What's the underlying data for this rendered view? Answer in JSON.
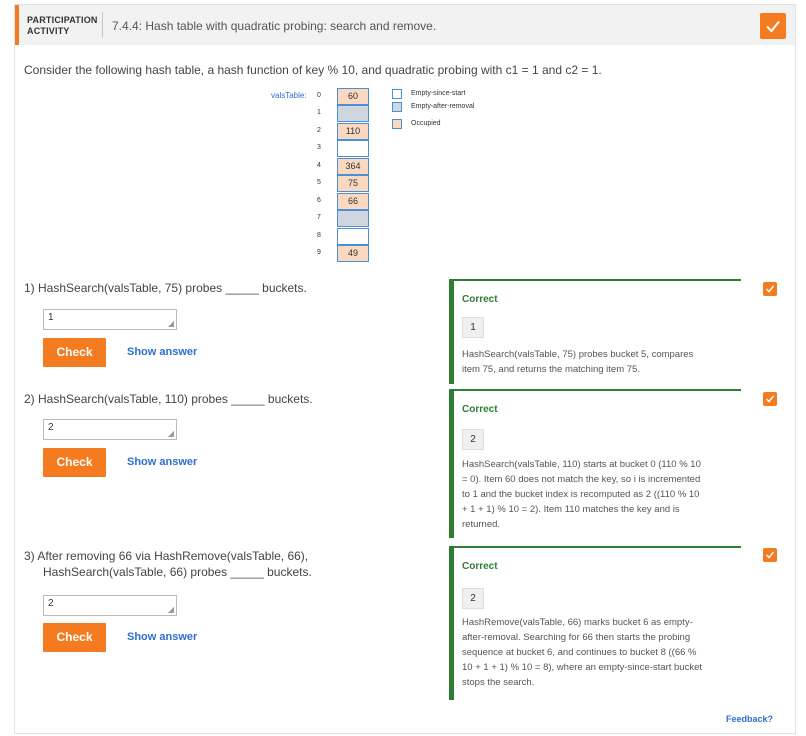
{
  "header": {
    "participation_label_line1": "PARTICIPATION",
    "participation_label_line2": "ACTIVITY",
    "title": "7.4.4: Hash table with quadratic probing: search and remove.",
    "completed_icon": "checkmark-icon"
  },
  "intro": "Consider the following hash table, a hash function of key % 10, and quadratic probing with c1 = 1 and c2 = 1.",
  "table": {
    "label": "valsTable:",
    "buckets": [
      {
        "index": "0",
        "value": "60",
        "state": "occupied"
      },
      {
        "index": "1",
        "value": "",
        "state": "removed"
      },
      {
        "index": "2",
        "value": "110",
        "state": "occupied"
      },
      {
        "index": "3",
        "value": "",
        "state": "empty"
      },
      {
        "index": "4",
        "value": "364",
        "state": "occupied"
      },
      {
        "index": "5",
        "value": "75",
        "state": "occupied"
      },
      {
        "index": "6",
        "value": "66",
        "state": "occupied"
      },
      {
        "index": "7",
        "value": "",
        "state": "removed"
      },
      {
        "index": "8",
        "value": "",
        "state": "empty"
      },
      {
        "index": "9",
        "value": "49",
        "state": "occupied"
      }
    ]
  },
  "legend": [
    {
      "label": "Empty-since-start",
      "color": "#ffffff"
    },
    {
      "label": "Empty-after-removal",
      "color": "#cfd6dd"
    },
    {
      "label": "Occupied",
      "color": "#fbd8c0"
    }
  ],
  "questions": [
    {
      "number": "1)",
      "text_line1": "HashSearch(valsTable, 75) probes _____ buckets.",
      "text_line2": "",
      "input_value": "1",
      "check_label": "Check",
      "show_answer_label": "Show answer",
      "feedback_title": "Correct",
      "feedback_answer": "1",
      "feedback_lines": [
        "HashSearch(valsTable, 75) probes bucket 5, compares",
        "item 75, and returns the matching item 75."
      ]
    },
    {
      "number": "2)",
      "text_line1": "HashSearch(valsTable, 110) probes _____ buckets.",
      "text_line2": "",
      "input_value": "2",
      "check_label": "Check",
      "show_answer_label": "Show answer",
      "feedback_title": "Correct",
      "feedback_answer": "2",
      "feedback_lines": [
        "HashSearch(valsTable, 110) starts at bucket 0 (110 % 10",
        "= 0). Item 60 does not match the key, so i is incremented",
        "to 1 and the bucket index is recomputed as 2 ((110 % 10",
        "+ 1 + 1) % 10 = 2). Item 110 matches the key and is",
        "returned."
      ]
    },
    {
      "number": "3)",
      "text_line1": "After removing 66 via HashRemove(valsTable, 66),",
      "text_line2": "HashSearch(valsTable, 66) probes _____ buckets.",
      "input_value": "2",
      "check_label": "Check",
      "show_answer_label": "Show answer",
      "feedback_title": "Correct",
      "feedback_answer": "2",
      "feedback_lines": [
        "HashRemove(valsTable, 66) marks bucket 6 as empty-",
        "after-removal. Searching for 66 then starts the probing",
        "sequence at bucket 6, and continues to bucket 8 ((66 %",
        "10 + 1 + 1) % 10 = 8), where an empty-since-start bucket",
        "stops the search."
      ]
    }
  ],
  "footer": {
    "feedback_link": "Feedback?"
  }
}
